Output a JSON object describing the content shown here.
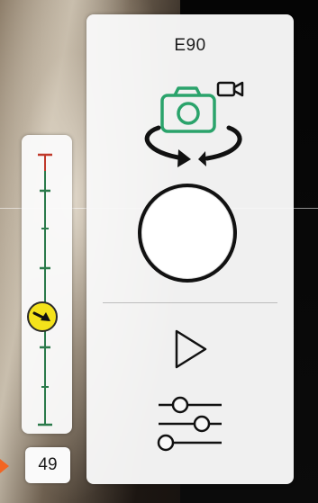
{
  "camera": {
    "model": "E90"
  },
  "controls": {
    "switch_camera_icon": "camera-rotate-icon",
    "video_mode_icon": "video-camera-icon",
    "shutter_icon": "shutter-circle",
    "play_icon": "play-icon",
    "settings_icon": "sliders-icon"
  },
  "slider": {
    "value": "49",
    "knob_icon": "arrow-right-down-icon"
  },
  "colors": {
    "accent_green": "#2aa36b",
    "track_green": "#2b7a4b",
    "top_mark_red": "#c0392b",
    "knob_yellow": "#f4e21b",
    "pointer_orange": "#f26522"
  }
}
